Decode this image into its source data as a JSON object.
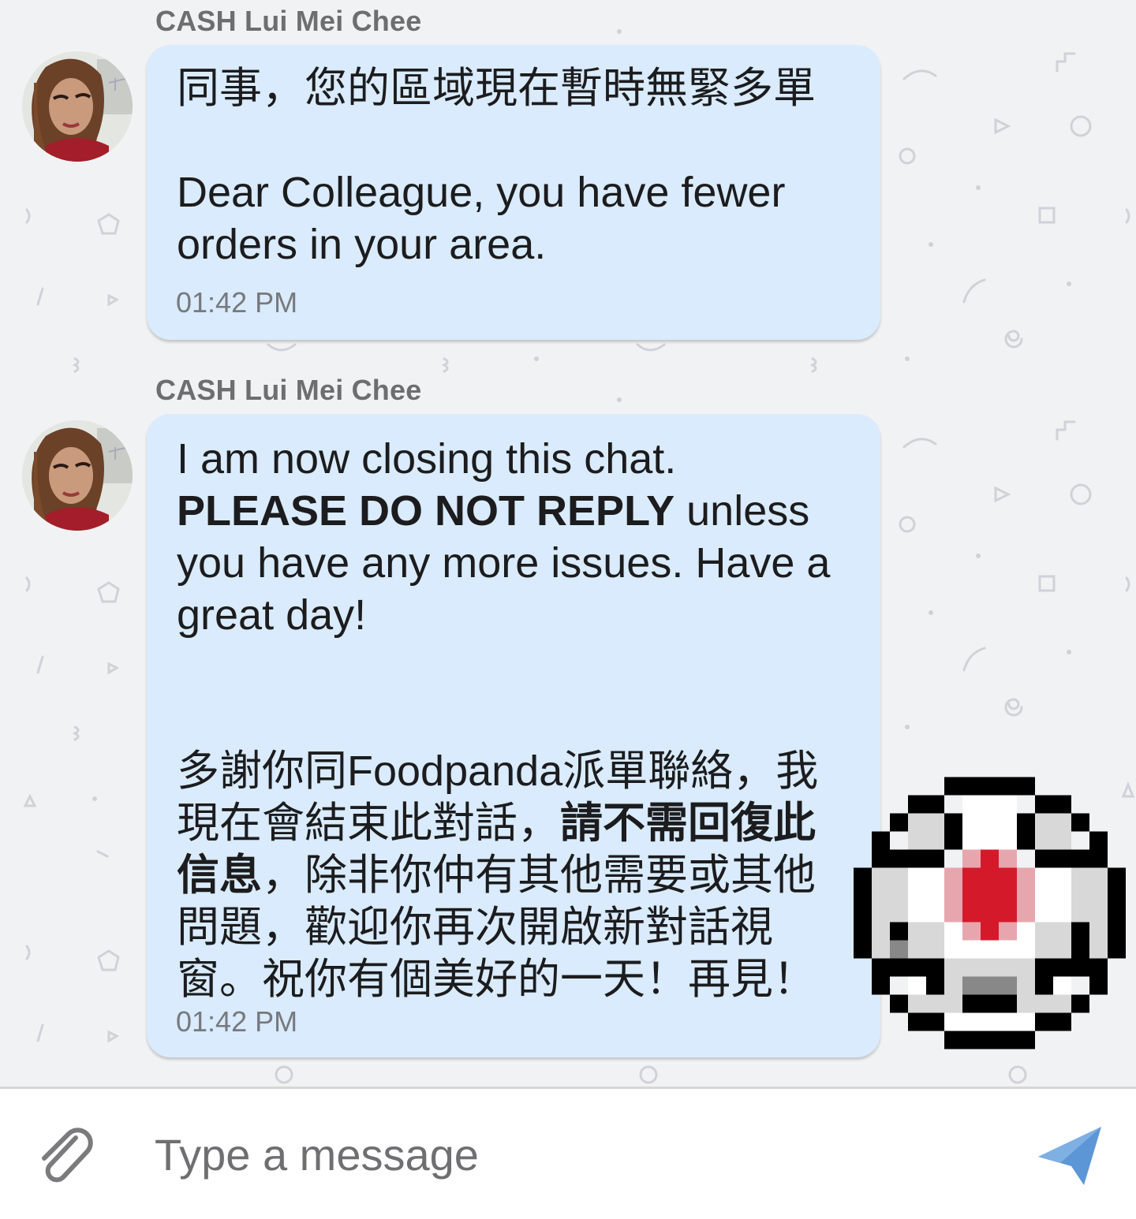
{
  "messages": [
    {
      "sender": "CASH Lui Mei Chee",
      "lines": [
        "同事，您的區域現在暫時無緊多單",
        "",
        "Dear Colleague, you have fewer",
        "orders in your area."
      ],
      "time": "01:42 PM"
    },
    {
      "sender": "CASH Lui Mei Chee",
      "text": {
        "l1": "I am now closing this chat.",
        "l2_bold": "PLEASE DO NOT REPLY",
        "l2_rest": " unless",
        "l3": "you have any more issues. Have a",
        "l4": "great day!",
        "c1": "多謝你同Foodpanda派單聯絡，我",
        "c2_a": "現在會結束此對話，",
        "c2_bold": "請不需回復此",
        "c3_bold": "信息",
        "c3_rest": "，除非你仲有其他需要或其他",
        "c4": "問題，歡迎你再次開啟新對話視",
        "c5": "窗。祝你有個美好的一天！再見！"
      },
      "time": "01:42 PM"
    }
  ],
  "composer": {
    "placeholder": "Type a message",
    "attach_icon": "paperclip-icon",
    "send_icon": "send-paper-plane-icon"
  },
  "colors": {
    "bubble": "#d9ebfc",
    "background": "#f1f2f4",
    "send_icon": "#5d96d6",
    "sticker_dot": "#d41a2a"
  }
}
